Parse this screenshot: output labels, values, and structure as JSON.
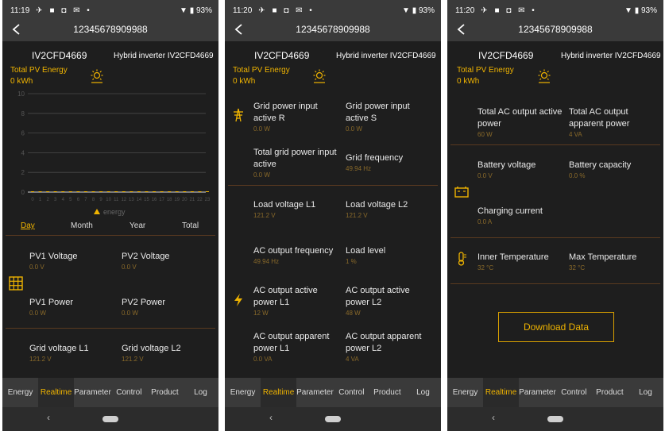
{
  "colors": {
    "accent": "#f0b400",
    "bg": "#1e1e1e",
    "bar": "#3a3a3a",
    "value": "#8a6a2a"
  },
  "screens": [
    {
      "status": {
        "time": "11:19",
        "battery": "93%"
      },
      "serial": "12345678909988",
      "device_name": "IV2CFD4669",
      "device_model": "Hybrid inverter IV2CFD4669",
      "pv_title": "Total PV Energy",
      "pv_value": "0 kWh"
    },
    {
      "status": {
        "time": "11:20",
        "battery": "93%"
      },
      "serial": "12345678909988",
      "device_name": "IV2CFD4669",
      "device_model": "Hybrid inverter IV2CFD4669",
      "pv_title": "Total PV Energy",
      "pv_value": "0 kWh"
    },
    {
      "status": {
        "time": "11:20",
        "battery": "93%"
      },
      "serial": "12345678909988",
      "device_name": "IV2CFD4669",
      "device_model": "Hybrid inverter IV2CFD4669",
      "pv_title": "Total PV Energy",
      "pv_value": "0 kWh"
    }
  ],
  "chart_data": {
    "type": "bar",
    "categories": [
      "0",
      "1",
      "2",
      "3",
      "4",
      "5",
      "6",
      "7",
      "8",
      "9",
      "10",
      "11",
      "12",
      "13",
      "14",
      "15",
      "16",
      "17",
      "18",
      "19",
      "20",
      "21",
      "22",
      "23"
    ],
    "values": [
      0,
      0,
      0,
      0,
      0,
      0,
      0,
      0,
      0,
      0,
      0,
      0,
      0,
      0,
      0,
      0,
      0,
      0,
      0,
      0,
      0,
      0,
      0,
      0
    ],
    "y_ticks": [
      "0",
      "2",
      "4",
      "6",
      "8",
      "10"
    ],
    "ylim": [
      0,
      10
    ],
    "legend": "energy",
    "grid": true
  },
  "periods": [
    "Day",
    "Month",
    "Year",
    "Total"
  ],
  "screen1_items": {
    "pv1_voltage": {
      "label": "PV1 Voltage",
      "value": "0.0 V"
    },
    "pv2_voltage": {
      "label": "PV2 Voltage",
      "value": "0.0 V"
    },
    "pv1_power": {
      "label": "PV1 Power",
      "value": "0.0 W"
    },
    "pv2_power": {
      "label": "PV2 Power",
      "value": "0.0 W"
    },
    "grid_voltage_l1": {
      "label": "Grid voltage L1",
      "value": "121.2 V"
    },
    "grid_voltage_l2": {
      "label": "Grid voltage L2",
      "value": "121.2 V"
    }
  },
  "screen2_items": {
    "grid_power_r": {
      "label1": "Grid power input",
      "label2": "active R",
      "value": "0.0 W"
    },
    "grid_power_s": {
      "label1": "Grid power input",
      "label2": "active S",
      "value": "0.0 W"
    },
    "total_grid_power": {
      "label1": "Total grid power input",
      "label2": "active",
      "value": "0.0 W"
    },
    "grid_frequency": {
      "label": "Grid frequency",
      "value": "49.94 Hz"
    },
    "load_voltage_l1": {
      "label": "Load voltage L1",
      "value": "121.2 V"
    },
    "load_voltage_l2": {
      "label": "Load voltage L2",
      "value": "121.2 V"
    },
    "ac_output_frequency": {
      "label": "AC output frequency",
      "value": "49.94 Hz"
    },
    "load_level": {
      "label": "Load level",
      "value": "1 %"
    },
    "ac_active_l1": {
      "label1": "AC output active",
      "label2": "power L1",
      "value": "12 W"
    },
    "ac_active_l2": {
      "label1": "AC output active",
      "label2": "power L2",
      "value": "48 W"
    },
    "ac_apparent_l1": {
      "label1": "AC output apparent",
      "label2": "power L1",
      "value": "0.0 VA"
    },
    "ac_apparent_l2": {
      "label1": "AC output apparent",
      "label2": "power L2",
      "value": "4 VA"
    }
  },
  "screen3_items": {
    "total_ac_active": {
      "label1": "Total AC output active",
      "label2": "power",
      "value": "60 W"
    },
    "total_ac_apparent": {
      "label1": "Total AC output",
      "label2": "apparent power",
      "value": "4 VA"
    },
    "battery_voltage": {
      "label": "Battery voltage",
      "value": "0.0 V"
    },
    "battery_capacity": {
      "label": "Battery capacity",
      "value": "0.0 %"
    },
    "charging_current": {
      "label": "Charging current",
      "value": "0.0 A"
    },
    "inner_temperature": {
      "label": "Inner Temperature",
      "value": "32 °C"
    },
    "max_temperature": {
      "label": "Max Temperature",
      "value": "32 °C"
    },
    "download_label": "Download Data"
  },
  "tabs": [
    "Energy",
    "Realtime",
    "Parameter",
    "Control",
    "Product",
    "Log"
  ]
}
